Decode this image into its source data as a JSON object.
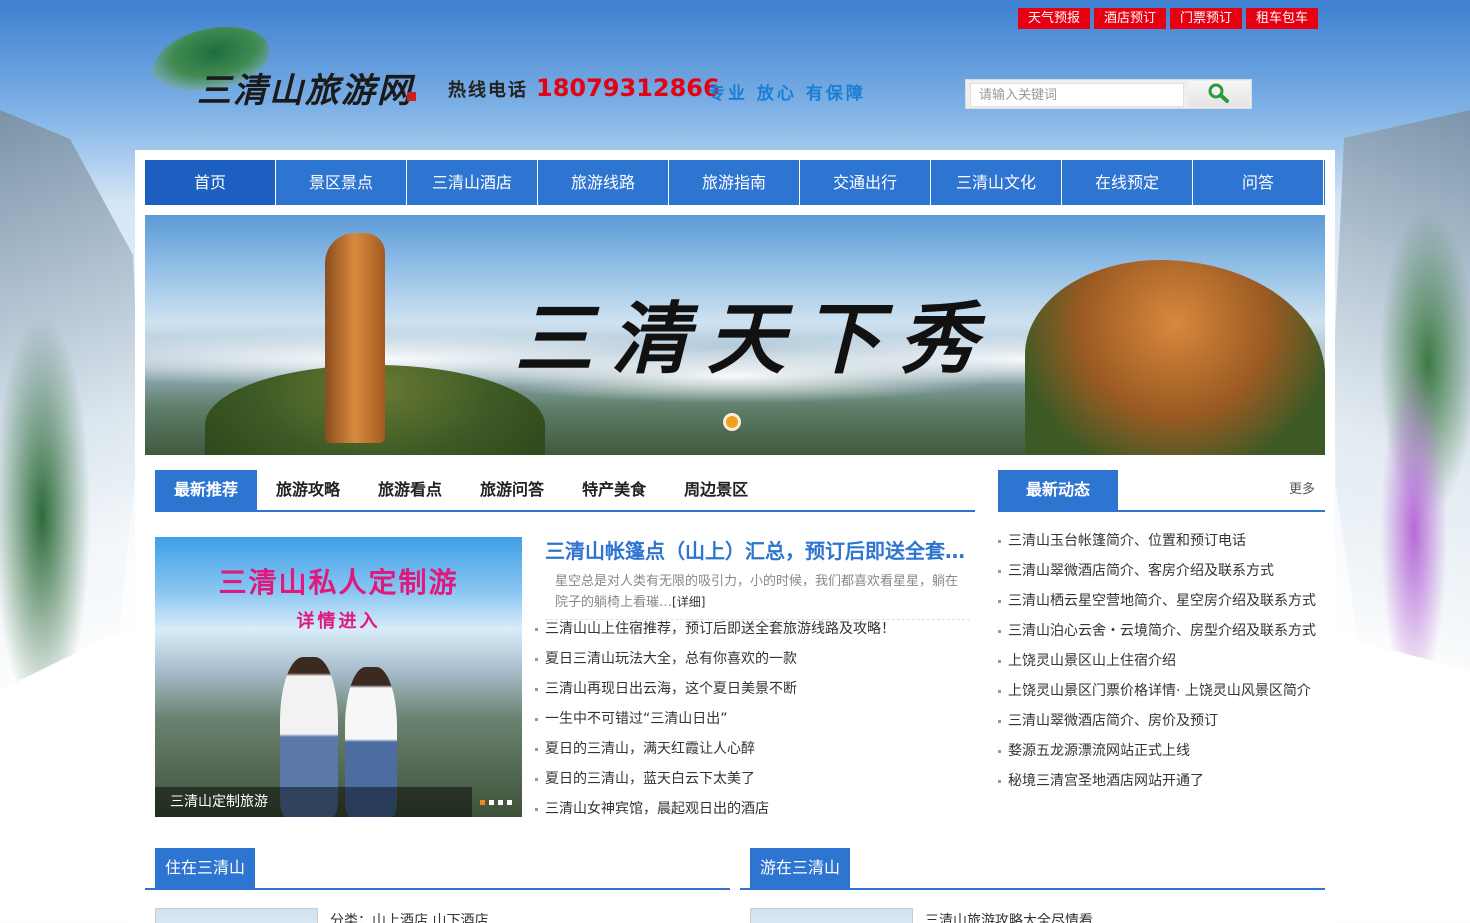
{
  "top_links": [
    "天气预报",
    "酒店预订",
    "门票预订",
    "租车包车"
  ],
  "header": {
    "logo_text": "三清山旅游网",
    "hotline_label": "热线电话",
    "hotline_number": "18079312866",
    "slogan": "专业 放心 有保障",
    "search_placeholder": "请输入关键词",
    "search_icon": "magnifier-icon"
  },
  "nav": [
    "首页",
    "景区景点",
    "三清山酒店",
    "旅游线路",
    "旅游指南",
    "交通出行",
    "三清山文化",
    "在线预定",
    "问答"
  ],
  "banner": {
    "title": "三清天下秀",
    "active_slide": 1
  },
  "tabs": [
    "最新推荐",
    "旅游攻略",
    "旅游看点",
    "旅游问答",
    "特产美食",
    "周边景区"
  ],
  "feature": {
    "line1": "三清山私人定制游",
    "line2": "详情进入",
    "caption": "三清山定制旅游",
    "slide_count": 4,
    "active_slide": 1
  },
  "headline": {
    "title": "三清山帐篷点（山上）汇总，预订后即送全套旅游线路",
    "desc": "星空总是对人类有无限的吸引力，小的时候，我们都喜欢看星星，躺在院子的躺椅上看璀…",
    "more": "[详细]"
  },
  "news": [
    "三清山山上住宿推荐，预订后即送全套旅游线路及攻略！",
    "夏日三清山玩法大全，总有你喜欢的一款",
    "三清山再现日出云海，这个夏日美景不断",
    "一生中不可错过“三清山日出”",
    "夏日的三清山，满天红霞让人心醉",
    "夏日的三清山，蓝天白云下太美了",
    "三清山女神宾馆，晨起观日出的酒店"
  ],
  "dynamics": {
    "title": "最新动态",
    "more": "更多",
    "items": [
      "三清山玉台帐篷简介、位置和预订电话",
      "三清山翠微酒店简介、客房介绍及联系方式",
      "三清山栖云星空营地简介、星空房介绍及联系方式",
      "三清山泊心云舍・云境简介、房型介绍及联系方式",
      "上饶灵山景区山上住宿介绍",
      "上饶灵山景区门票价格详情· 上饶灵山风景区简介",
      "三清山翠微酒店简介、房价及预订",
      "婺源五龙源漂流网站正式上线",
      "秘境三清宫圣地酒店网站开通了"
    ]
  },
  "sections": {
    "left_title": "住在三清山",
    "left_text": "分类：山上酒店 山下酒店",
    "right_title": "游在三清山",
    "right_text": "三清山旅游攻略大全尽情看"
  }
}
